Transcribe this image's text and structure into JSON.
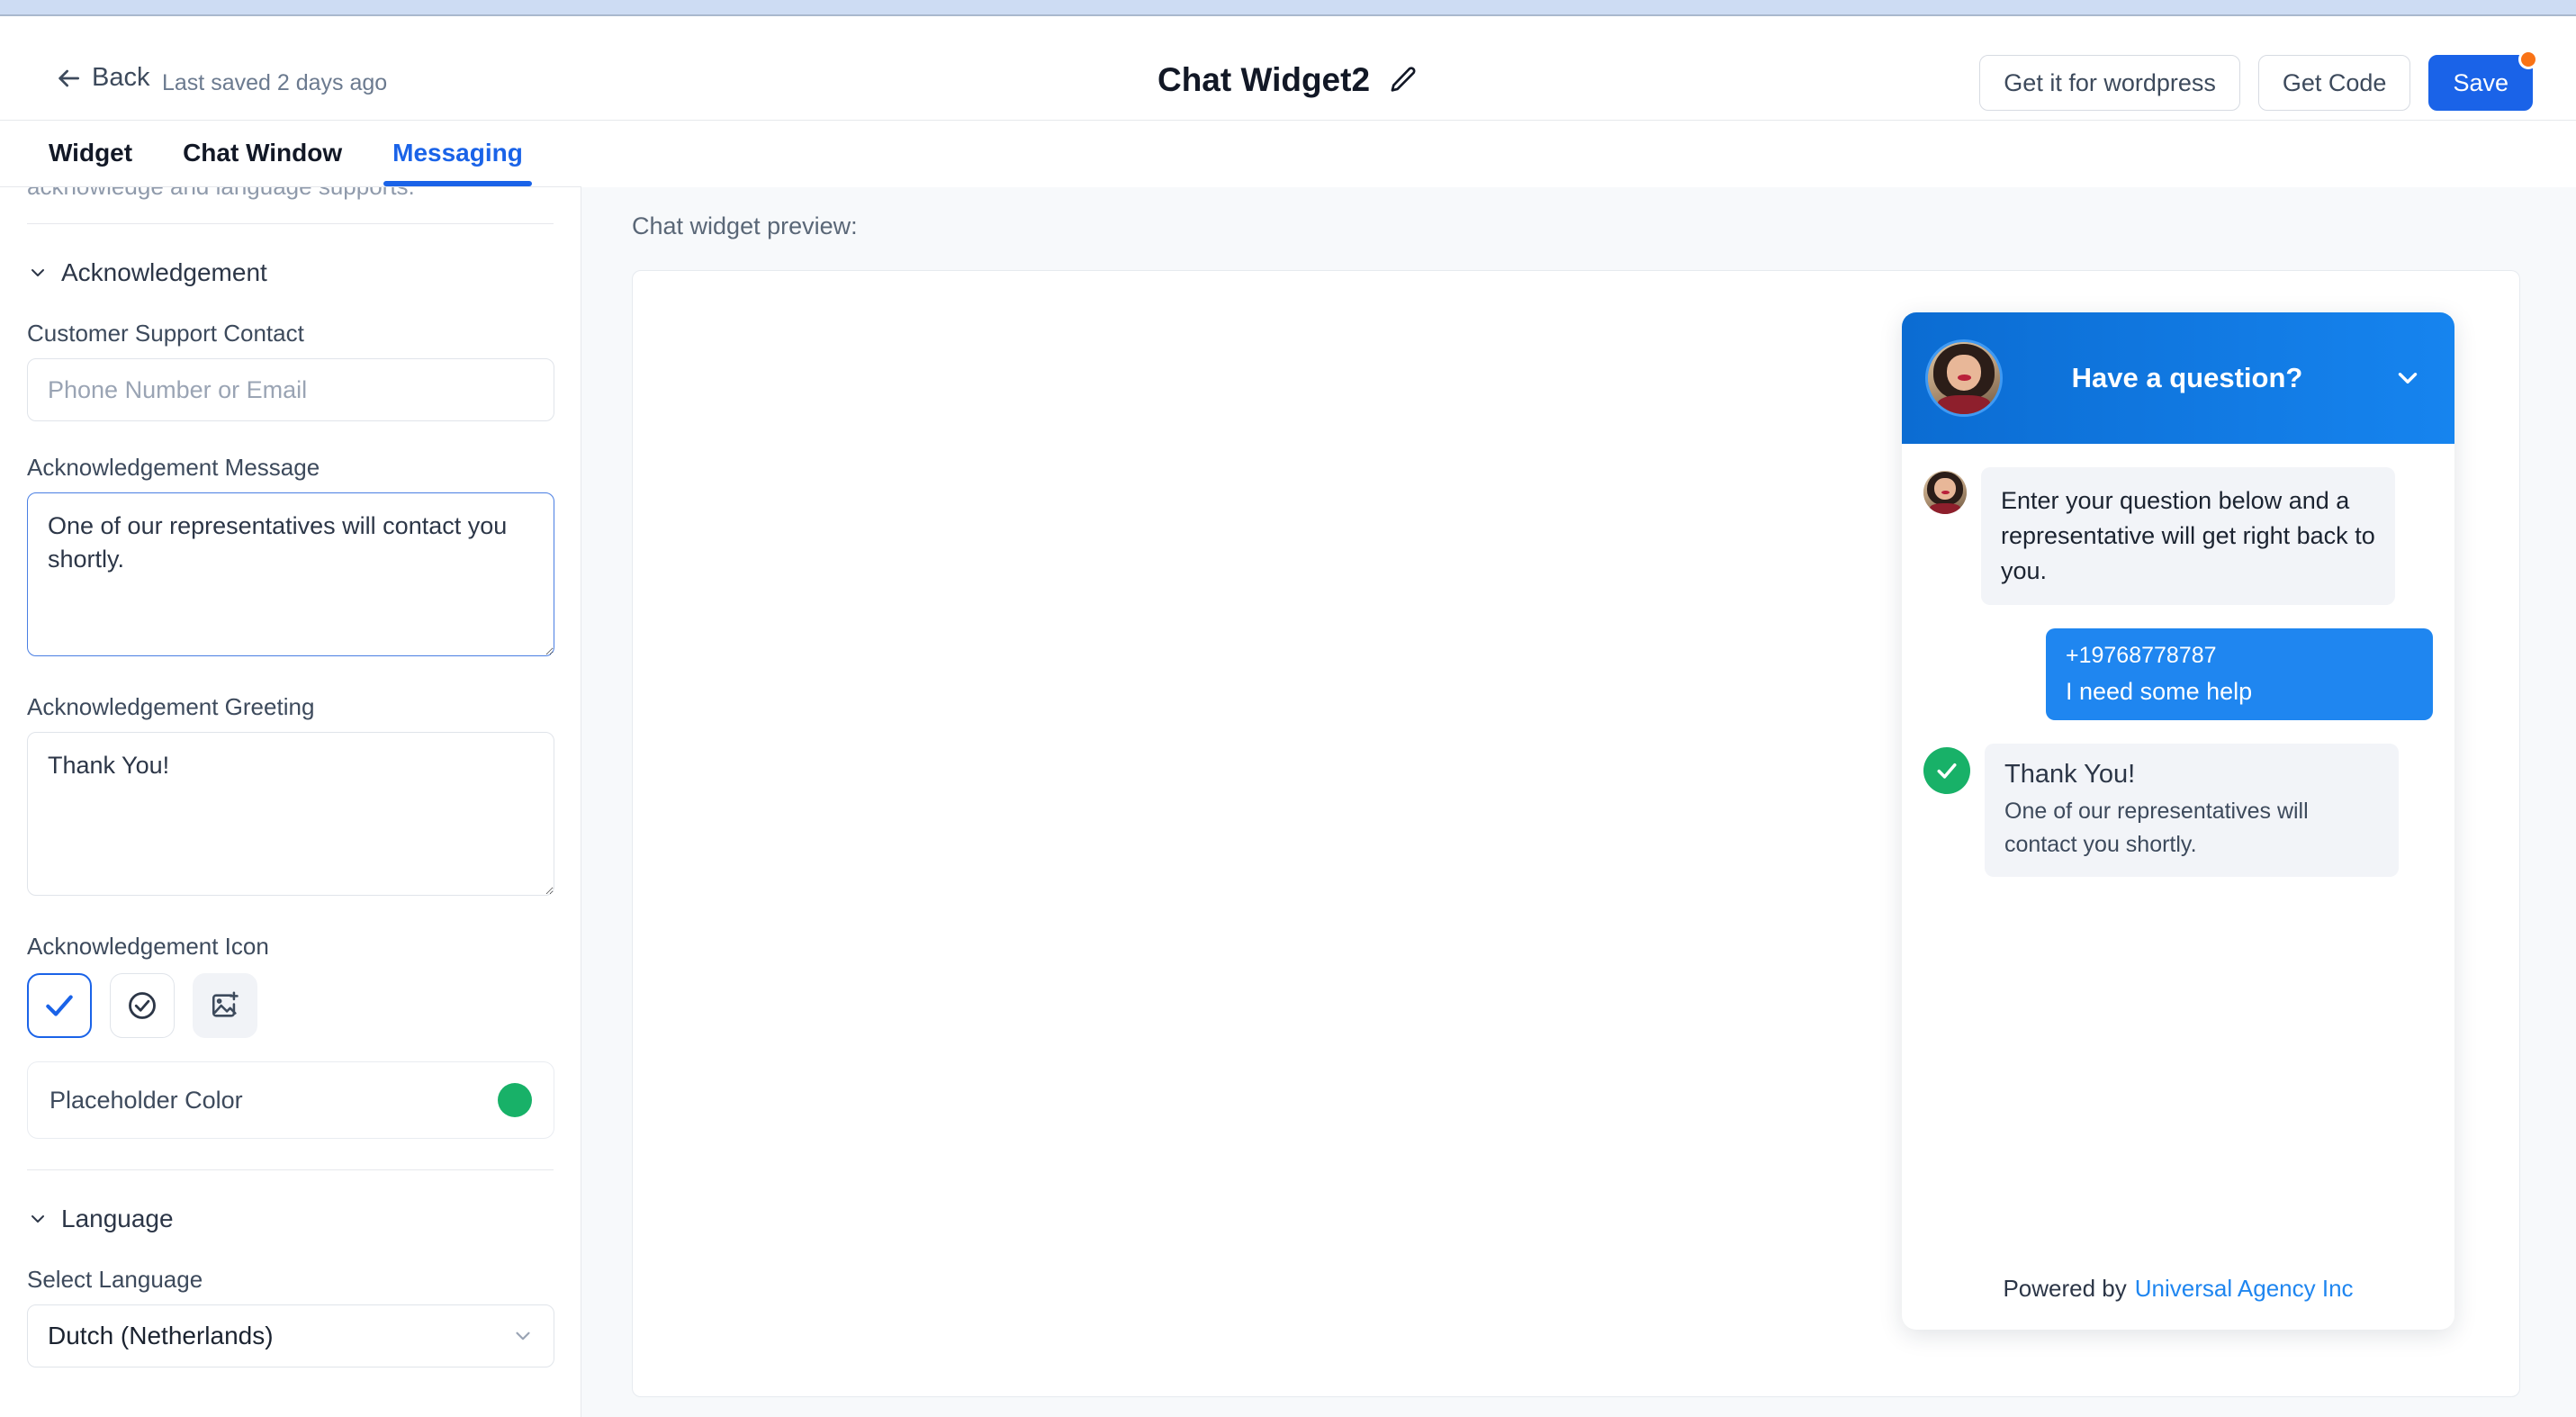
{
  "header": {
    "back_label": "Back",
    "last_saved": "Last saved 2 days ago",
    "title": "Chat Widget2",
    "edit_icon": "pencil-icon",
    "actions": {
      "wordpress": "Get it for wordpress",
      "get_code": "Get Code",
      "save": "Save"
    }
  },
  "tabs": [
    {
      "label": "Widget",
      "active": false
    },
    {
      "label": "Chat Window",
      "active": false
    },
    {
      "label": "Messaging",
      "active": true
    }
  ],
  "sidebar": {
    "scrolled_text": "acknowledge and language supports.",
    "acknowledgement": {
      "section_label": "Acknowledgement",
      "contact_label": "Customer Support Contact",
      "contact_placeholder": "Phone Number or Email",
      "contact_value": "",
      "message_label": "Acknowledgement Message",
      "message_value": "One of our representatives will contact you shortly.",
      "greeting_label": "Acknowledgement Greeting",
      "greeting_value": "Thank You!",
      "icon_label": "Acknowledgement Icon",
      "icon_options": [
        {
          "name": "check-icon",
          "selected": true
        },
        {
          "name": "circle-check-icon",
          "selected": false
        },
        {
          "name": "image-upload-icon",
          "selected": false
        }
      ],
      "color_label": "Placeholder Color",
      "color_value": "#18b168"
    },
    "language": {
      "section_label": "Language",
      "select_label": "Select Language",
      "selected": "Dutch (Netherlands)"
    }
  },
  "main": {
    "preview_label": "Chat widget preview:",
    "widget": {
      "header_title": "Have a question?",
      "header_gradient_from": "#0b6cd2",
      "header_gradient_to": "#1684ef",
      "avatar": "agent-avatar",
      "collapse_icon": "chevron-down-icon",
      "messages": [
        {
          "role": "agent",
          "text": "Enter your question below and a representative will get right back to you."
        },
        {
          "role": "user",
          "phone": "+19768778787",
          "text": "I need some help",
          "color": "#1f86f0"
        }
      ],
      "acknowledgement": {
        "icon": "check-circle-icon",
        "icon_color": "#18b168",
        "title": "Thank You!",
        "text": "One of our representatives will contact you shortly."
      },
      "footer": {
        "powered_by": "Powered by",
        "brand": "Universal Agency Inc"
      }
    }
  }
}
